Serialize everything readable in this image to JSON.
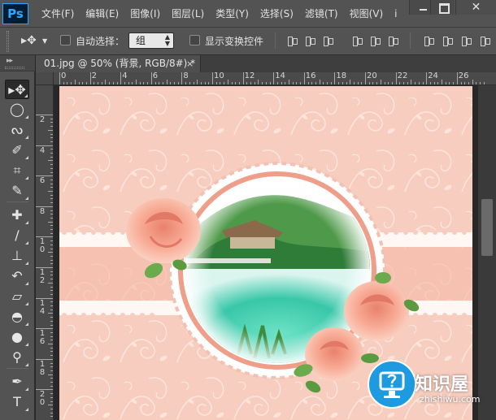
{
  "app": {
    "logo_text": "Ps",
    "menu": [
      "文件(F)",
      "编辑(E)",
      "图像(I)",
      "图层(L)",
      "类型(Y)",
      "选择(S)",
      "滤镜(T)",
      "视图(V)",
      "i"
    ],
    "window_controls": {
      "close_label": "✕"
    }
  },
  "options_bar": {
    "auto_select_label": "自动选择：",
    "auto_select_checked": false,
    "auto_select_target": "组",
    "show_transform_label": "显示变换控件",
    "show_transform_checked": false
  },
  "tools": [
    {
      "name": "move-tool",
      "glyph": "▸✥",
      "active": true
    },
    {
      "name": "marquee-tool",
      "glyph": "◯"
    },
    {
      "name": "lasso-tool",
      "glyph": "ᔓ"
    },
    {
      "name": "quick-select-tool",
      "glyph": "✐"
    },
    {
      "name": "crop-tool",
      "glyph": "⌗"
    },
    {
      "name": "eyedropper-tool",
      "glyph": "✎"
    },
    {
      "name": "healing-brush-tool",
      "glyph": "✚"
    },
    {
      "name": "brush-tool",
      "glyph": "∕"
    },
    {
      "name": "clone-stamp-tool",
      "glyph": "⊥"
    },
    {
      "name": "history-brush-tool",
      "glyph": "↶"
    },
    {
      "name": "eraser-tool",
      "glyph": "▱"
    },
    {
      "name": "paint-bucket-tool",
      "glyph": "◓"
    },
    {
      "name": "blur-tool",
      "glyph": "●"
    },
    {
      "name": "dodge-tool",
      "glyph": "⚲"
    },
    {
      "name": "pen-tool",
      "glyph": "✒"
    },
    {
      "name": "type-tool",
      "glyph": "T"
    }
  ],
  "document": {
    "tab_title": "01.jpg @ 50% (背景, RGB/8#) *",
    "close_glyph": "×"
  },
  "rulers": {
    "horizontal": [
      "0",
      "2",
      "4",
      "6",
      "8",
      "10",
      "12",
      "14",
      "16",
      "18",
      "20",
      "22",
      "24",
      "26"
    ],
    "vertical": [
      "2",
      "4",
      "6",
      "8",
      "1\n0",
      "1\n2",
      "1\n4",
      "1\n6",
      "1\n8",
      "2\n0"
    ]
  },
  "colors": {
    "ps_accent": "#31a8ff",
    "chrome": "#535353",
    "artwork_background": "#f7cdbf",
    "watermark_blue": "#1e9be0"
  },
  "watermark": {
    "title": "知识屋",
    "domain": "zhishiwu.com"
  }
}
